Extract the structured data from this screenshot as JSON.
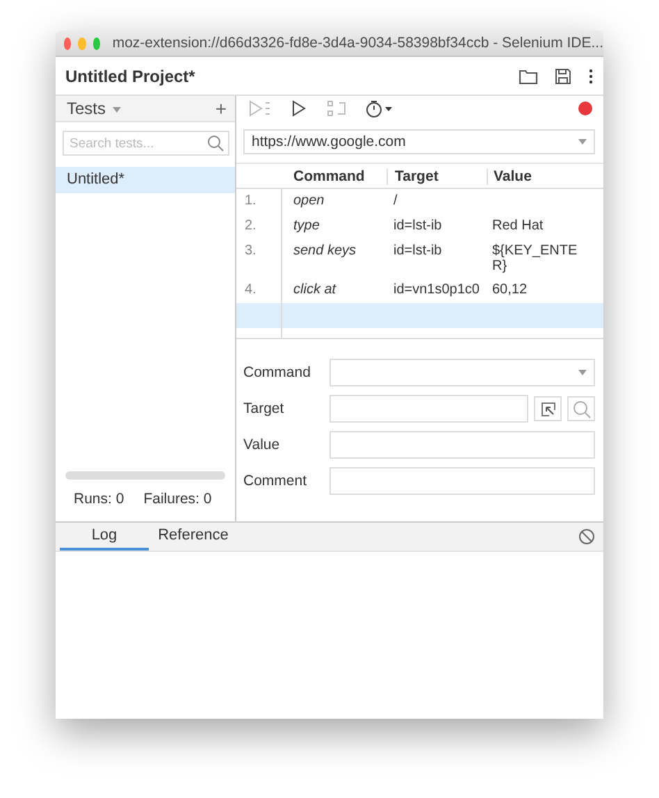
{
  "window": {
    "title": "moz-extension://d66d3326-fd8e-3d4a-9034-58398bf34ccb - Selenium IDE..."
  },
  "project": {
    "title": "Untitled Project*"
  },
  "tests_panel": {
    "title": "Tests",
    "add": "+",
    "search": {
      "placeholder": "Search tests..."
    },
    "tests": [
      {
        "name": "Untitled*",
        "selected": true
      }
    ],
    "runs": "Runs: 0",
    "failures": "Failures: 0"
  },
  "recording": true,
  "base_url": "https://www.google.com",
  "table": {
    "columns": [
      "Command",
      "Target",
      "Value"
    ],
    "rows": [
      {
        "index": "1.",
        "command": "open",
        "target": "/",
        "selected": false
      },
      {
        "index": "2.",
        "command": "type",
        "target": "id=lst-ib",
        "value": "Red Hat",
        "selected": false
      },
      {
        "index": "3.",
        "command": "send keys",
        "target": "id=lst-ib",
        "value": "${KEY_ENTER}",
        "selected": false
      },
      {
        "index": "4.",
        "command": "click at",
        "target": "id=vn1s0p1c0",
        "value": "60,12",
        "selected": false
      },
      {
        "selected": true
      }
    ]
  },
  "form": [
    {
      "label": "Command",
      "kind": "select"
    },
    {
      "label": "Target",
      "kind": "target"
    },
    {
      "label": "Value",
      "kind": "text"
    },
    {
      "label": "Comment",
      "kind": "text"
    }
  ],
  "bottom_tabs": [
    {
      "label": "Log",
      "selected": true
    },
    {
      "label": "Reference",
      "selected": false
    }
  ]
}
